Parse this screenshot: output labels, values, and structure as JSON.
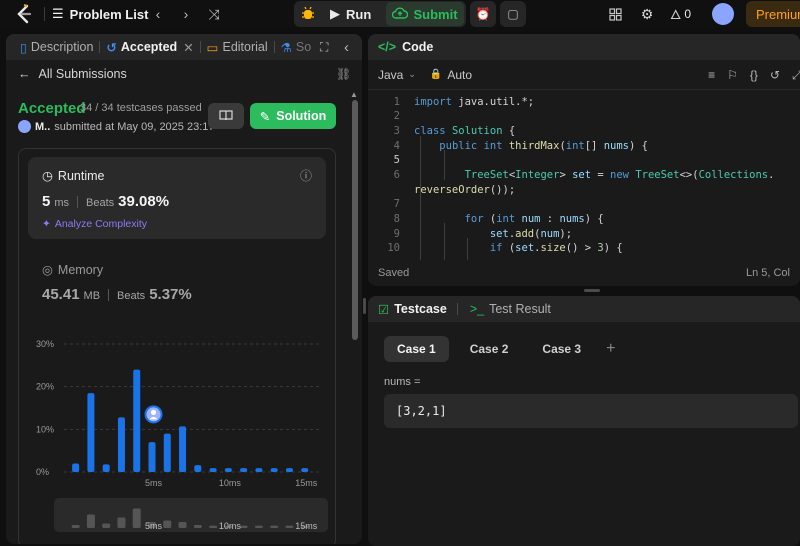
{
  "topbar": {
    "problem_list": "Problem List",
    "run": "Run",
    "submit": "Submit",
    "streak": "0",
    "premium": "Premium"
  },
  "left": {
    "tabs": [
      {
        "label": "Description"
      },
      {
        "label": "Accepted"
      },
      {
        "label": "Editorial"
      },
      {
        "label": "So"
      }
    ],
    "all_submissions": "All Submissions",
    "status": "Accepted",
    "testcases": "34 / 34 testcases passed",
    "user": "M..",
    "submitted": "submitted at May 09, 2025 23:17",
    "solution_btn": "Solution",
    "runtime": {
      "title": "Runtime",
      "value": "5",
      "unit": "ms",
      "beats_label": "Beats",
      "beats": "39.08%",
      "analyze": "Analyze Complexity"
    },
    "memory": {
      "title": "Memory",
      "value": "45.41",
      "unit": "MB",
      "beats_label": "Beats",
      "beats": "5.37%"
    }
  },
  "chart_data": {
    "type": "bar",
    "title": "",
    "xlabel": "",
    "ylabel": "",
    "x": [
      0.5,
      1.5,
      2.5,
      3.5,
      4.5,
      5.5,
      6.5,
      7.5,
      8.5,
      9.5,
      10.5,
      11.5,
      12.5,
      13.5,
      14.5,
      15.5
    ],
    "values": [
      2,
      18.5,
      1.8,
      12.8,
      24,
      7,
      9,
      10.7,
      1.6,
      0.9,
      0.9,
      0.9,
      0.9,
      0.9,
      0.9,
      0.9
    ],
    "highlight_x": 5,
    "y_ticks": [
      "30%",
      "20%",
      "10%",
      "0%"
    ],
    "ylim": [
      0,
      30
    ],
    "x_ticks": [
      "5ms",
      "10ms",
      "15ms"
    ],
    "x_tick_values": [
      5,
      10,
      15
    ],
    "bar_color": "#1a73e8",
    "mini_values": [
      1.0,
      4.5,
      1.5,
      3.5,
      6.5,
      2.0,
      2.5,
      2.0,
      1.0,
      0.8,
      0.8,
      0.8,
      0.8,
      0.8,
      0.8,
      0.8
    ]
  },
  "code": {
    "title": "Code",
    "language": "Java",
    "auto": "Auto",
    "status": "Saved",
    "cursor": "Ln 5, Col",
    "line_numbers": [
      "1",
      "2",
      "3",
      "4",
      "5",
      "6",
      "",
      "7",
      "8",
      "9",
      "10"
    ]
  },
  "test": {
    "tab_testcase": "Testcase",
    "tab_result": "Test Result",
    "cases": [
      "Case 1",
      "Case 2",
      "Case 3"
    ],
    "input_label": "nums =",
    "input_value": "[3,2,1]"
  }
}
